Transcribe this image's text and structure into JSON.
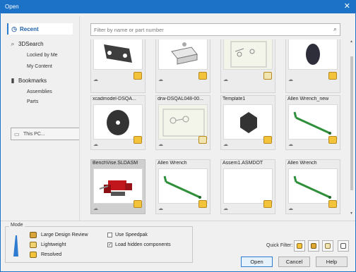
{
  "window": {
    "title": "Open"
  },
  "sidebar": {
    "recent": "Recent",
    "threeD_search": "3DSearch",
    "locked_by_me": "Locked by Me",
    "my_content": "My Content",
    "bookmarks": "Bookmarks",
    "assemblies": "Assemblies",
    "parts": "Parts",
    "this_pc": "This PC..."
  },
  "search": {
    "placeholder": "Filter by name or part number"
  },
  "files": [
    {
      "label": "",
      "kind": "plate"
    },
    {
      "label": "",
      "kind": "block"
    },
    {
      "label": "",
      "kind": "drawing"
    },
    {
      "label": "",
      "kind": "disc"
    },
    {
      "label": "xcadmodel-DSQA...",
      "kind": "washer"
    },
    {
      "label": "drw-DSQAL048-00...",
      "kind": "drawing"
    },
    {
      "label": "Template1",
      "kind": "hexagon"
    },
    {
      "label": "Allen Wrench_new",
      "kind": "wrench"
    },
    {
      "label": "BenchVise.SLDASM",
      "kind": "vise"
    },
    {
      "label": "Allen Wrench",
      "kind": "wrench"
    },
    {
      "label": "Assem1.ASMDOT",
      "kind": "empty"
    },
    {
      "label": "Allen Wrench",
      "kind": "wrench"
    }
  ],
  "mode": {
    "title": "Mode",
    "options": [
      "Large Design Review",
      "Lightweight",
      "Resolved"
    ],
    "use_speedpak": "Use Speedpak",
    "load_hidden": "Load hidden components",
    "load_hidden_checked": true,
    "use_speedpak_checked": false
  },
  "quick_filter": {
    "label": "Quick Filter:"
  },
  "buttons": {
    "open": "Open",
    "cancel": "Cancel",
    "help": "Help"
  },
  "colors": {
    "accent": "#1b72c6",
    "badge": "#f3c33c",
    "wrench": "#2f8f3a"
  }
}
